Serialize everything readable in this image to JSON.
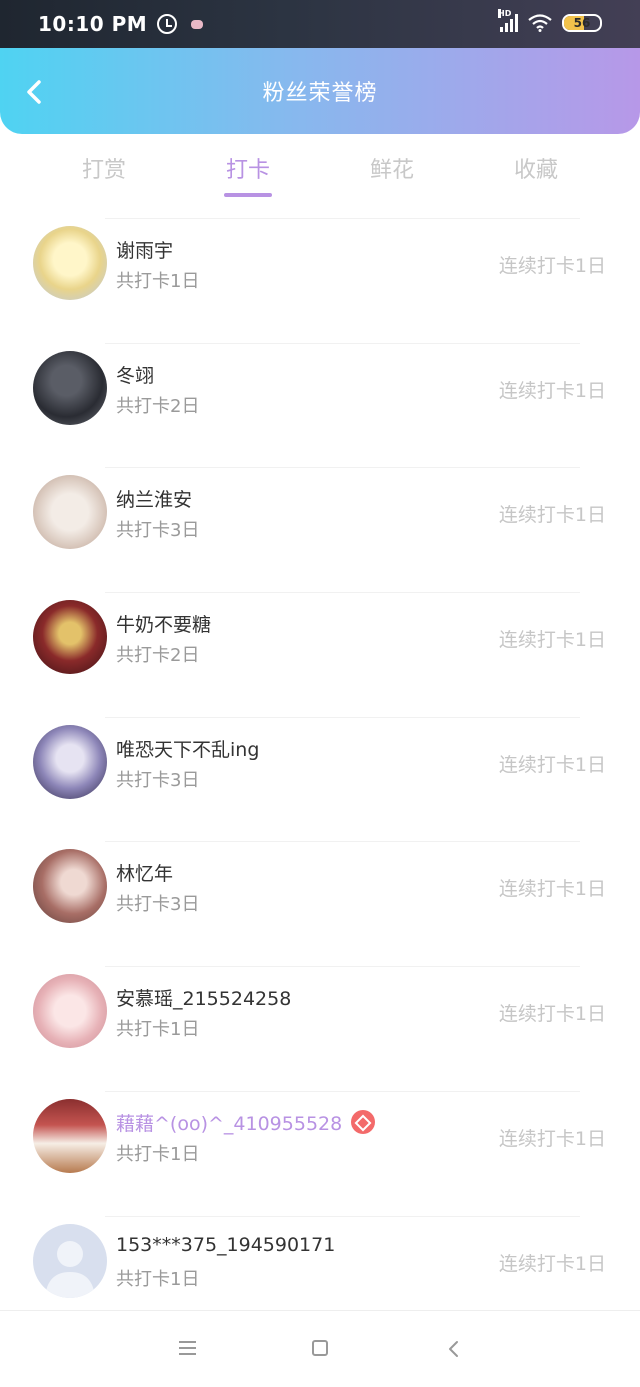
{
  "status_bar": {
    "time": "10:10 PM",
    "network": "HD",
    "battery": "56",
    "battery_level": 0.56,
    "icons": [
      "alarm-icon",
      "message-icon",
      "signal-icon",
      "wifi-icon",
      "battery-icon"
    ]
  },
  "header": {
    "title": "粉丝荣誉榜",
    "back_icon": "chevron-left-icon"
  },
  "tabs": [
    {
      "label": "打赏"
    },
    {
      "label": "打卡"
    },
    {
      "label": "鲜花"
    },
    {
      "label": "收藏"
    }
  ],
  "active_tab": "打卡",
  "colors": {
    "accent": "#b892e3",
    "header_gradient": [
      "#4fd3f2",
      "#b798e8"
    ],
    "badge": "#f36a6a"
  },
  "fans": [
    {
      "name": "谢雨宇",
      "count": "共打卡1日",
      "streak": "连续打卡1日"
    },
    {
      "name": "冬翊",
      "count": "共打卡2日",
      "streak": "连续打卡1日"
    },
    {
      "name": "纳兰淮安",
      "count": "共打卡3日",
      "streak": "连续打卡1日"
    },
    {
      "name": "牛奶不要糖",
      "count": "共打卡2日",
      "streak": "连续打卡1日"
    },
    {
      "name": "唯恐天下不乱ing",
      "count": "共打卡3日",
      "streak": "连续打卡1日"
    },
    {
      "name": "林忆年",
      "count": "共打卡3日",
      "streak": "连续打卡1日"
    },
    {
      "name": "安慕瑶_215524258",
      "count": "共打卡1日",
      "streak": "连续打卡1日"
    },
    {
      "name": "藉藉^(oo)^_410955528",
      "count": "共打卡1日",
      "streak": "连续打卡1日",
      "vip": true
    },
    {
      "name": "153***375_194590171",
      "count": "共打卡1日",
      "streak": "连续打卡1日"
    }
  ],
  "nav_bar": {
    "icons": [
      "menu-icon",
      "home-icon",
      "back-icon"
    ]
  }
}
